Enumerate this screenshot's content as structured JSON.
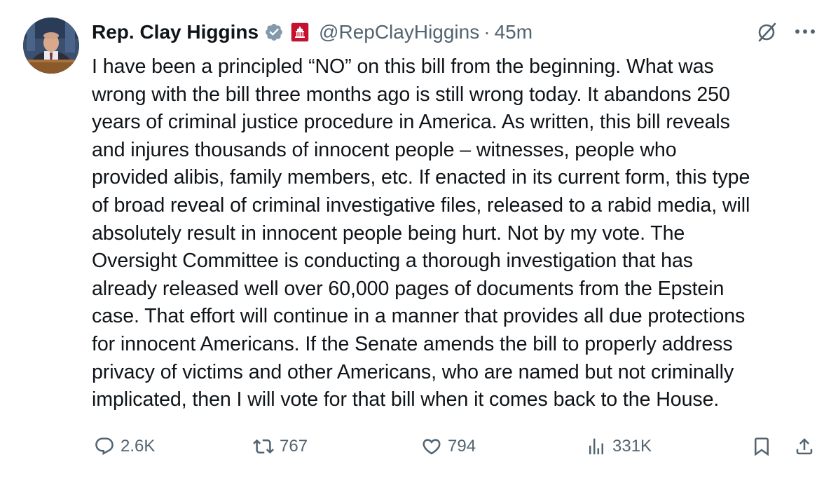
{
  "author": {
    "display_name": "Rep. Clay Higgins",
    "handle": "@RepClayHiggins",
    "separator": "·",
    "time_ago": "45m",
    "verified_icon": "verified-badge-icon",
    "affiliation_icon": "us-house-affiliation-icon"
  },
  "tweet": {
    "text": "I have been a principled “NO” on this bill from the beginning. What was\nwrong with the bill three months ago is still wrong today. It abandons 250\nyears of criminal justice procedure in America. As written, this bill reveals\nand injures thousands of innocent people – witnesses, people who\nprovided alibis, family members, etc. If enacted in its current form, this type\nof broad reveal of criminal investigative files, released to a rabid media, will\nabsolutely result in innocent people being hurt. Not by my vote. The\nOversight Committee is conducting a thorough investigation that has\nalready released well over 60,000 pages of documents from the Epstein\ncase. That effort will continue in a manner that provides all due protections\nfor innocent Americans. If the Senate amends the bill to properly address\nprivacy of victims and other Americans, who are named but not criminally\nimplicated, then I will vote for that bill when it comes back to the House."
  },
  "metrics": {
    "replies": "2.6K",
    "reposts": "767",
    "likes": "794",
    "views": "331K"
  },
  "colors": {
    "text": "#0f1419",
    "secondary": "#536471",
    "verified": "#829aab",
    "affiliation_red": "#c8102e"
  }
}
